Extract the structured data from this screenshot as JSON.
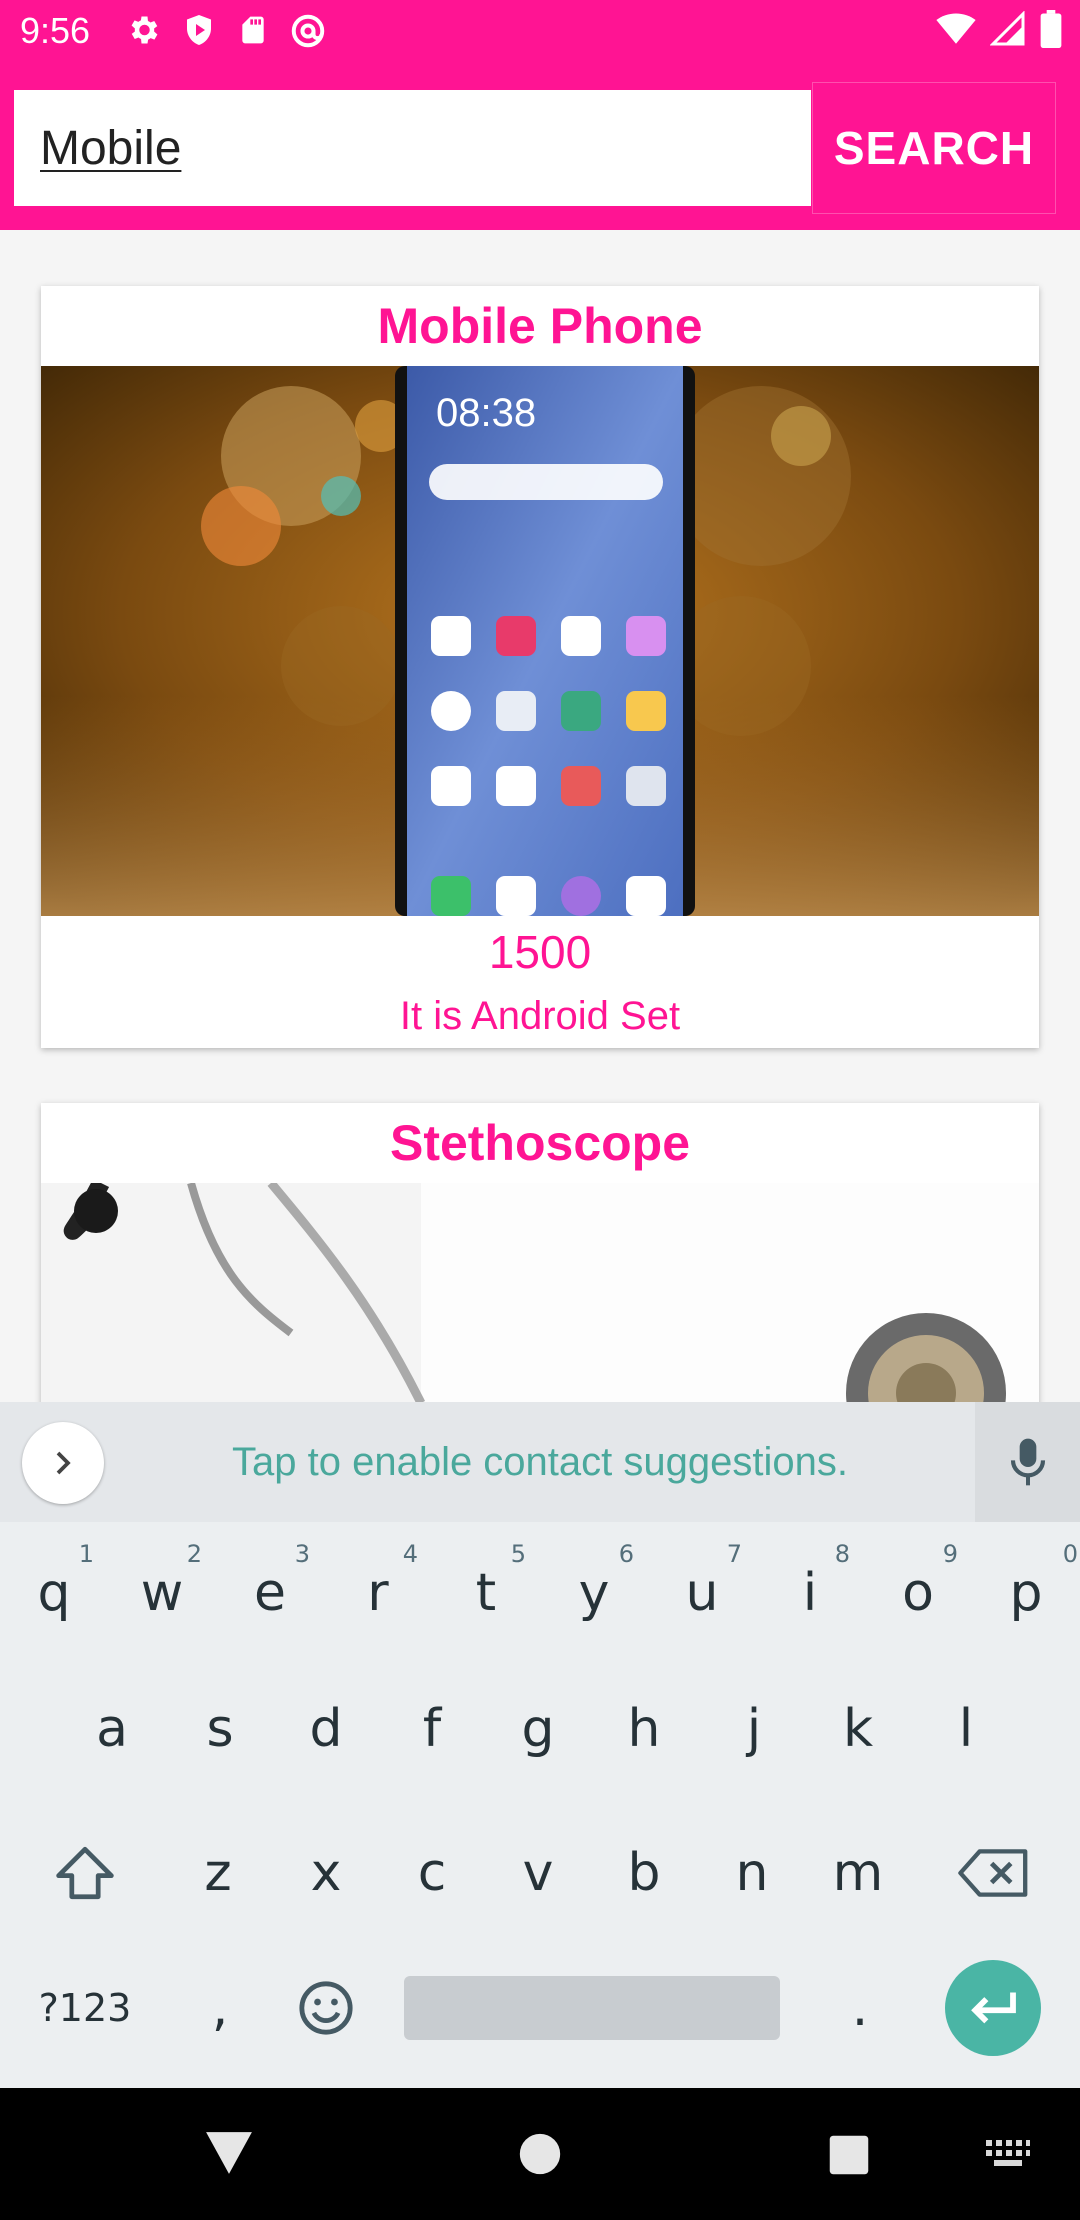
{
  "status_bar": {
    "time": "9:56",
    "left_icons": [
      "gear-icon",
      "play-shield-icon",
      "sd-card-icon",
      "at-sign-icon"
    ],
    "right_icons": [
      "wifi-icon",
      "signal-icon",
      "battery-icon"
    ]
  },
  "search": {
    "value": "Mobile",
    "button_label": "SEARCH"
  },
  "products": [
    {
      "title": "Mobile Phone",
      "image": "mobile-phone-photo",
      "price": "1500",
      "description": "It is Android Set",
      "phone_clock": "08:38"
    },
    {
      "title": "Stethoscope",
      "image": "stethoscope-photo"
    }
  ],
  "keyboard": {
    "suggestion_text": "Tap to enable contact suggestions.",
    "row1": [
      {
        "key": "q",
        "hint": "1"
      },
      {
        "key": "w",
        "hint": "2"
      },
      {
        "key": "e",
        "hint": "3"
      },
      {
        "key": "r",
        "hint": "4"
      },
      {
        "key": "t",
        "hint": "5"
      },
      {
        "key": "y",
        "hint": "6"
      },
      {
        "key": "u",
        "hint": "7"
      },
      {
        "key": "i",
        "hint": "8"
      },
      {
        "key": "o",
        "hint": "9"
      },
      {
        "key": "p",
        "hint": "0"
      }
    ],
    "row2": [
      "a",
      "s",
      "d",
      "f",
      "g",
      "h",
      "j",
      "k",
      "l"
    ],
    "row3": [
      "z",
      "x",
      "c",
      "v",
      "b",
      "n",
      "m"
    ],
    "symbols_key": "?123",
    "comma_key": ",",
    "period_key": "."
  },
  "colors": {
    "accent": "#ff1493",
    "keyboard_bg": "#eceff1",
    "enter_key": "#4ab5a5",
    "suggestion_text": "#4aa89c"
  }
}
